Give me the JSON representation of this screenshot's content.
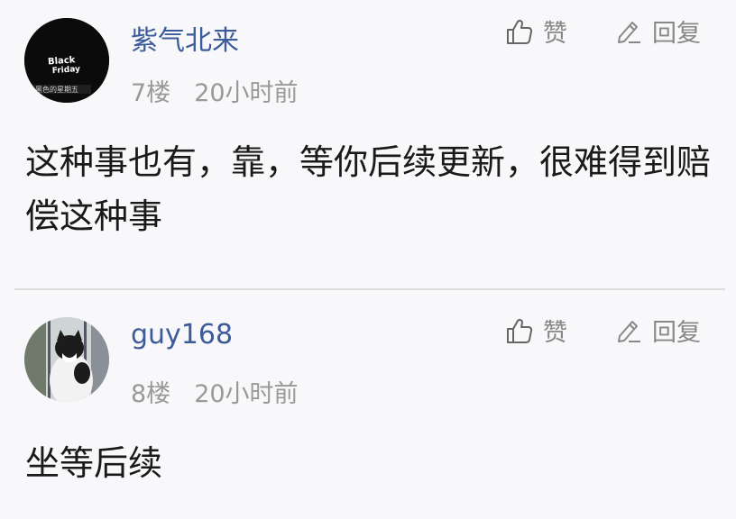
{
  "comments": [
    {
      "username": "紫气北来",
      "floor": "7楼",
      "time": "20小时前",
      "like_label": "赞",
      "reply_label": "回复",
      "content": "这种事也有，靠，等你后续更新，很难得到赔偿这种事",
      "avatar_text_1": "Black",
      "avatar_text_2": "Friday",
      "avatar_text_3": "黑色的星期五"
    },
    {
      "username": "guy168",
      "floor": "8楼",
      "time": "20小时前",
      "like_label": "赞",
      "reply_label": "回复",
      "content": "坐等后续"
    }
  ],
  "icons": {
    "like": "thumbs-up-icon",
    "reply": "pencil-icon"
  },
  "colors": {
    "username": "#3d5a99",
    "meta": "#999999",
    "action": "#888888",
    "divider": "#dcdcdc",
    "background": "#f8f8fa"
  }
}
